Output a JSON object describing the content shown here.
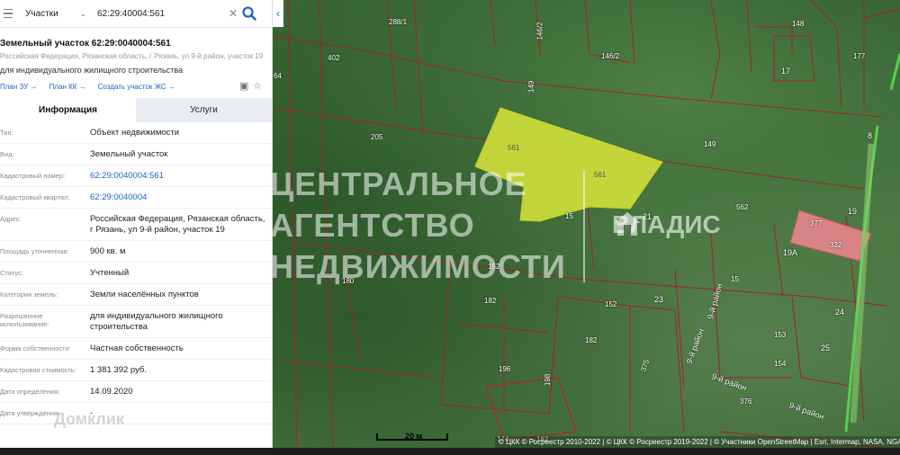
{
  "search": {
    "layer": "Участки",
    "query": "62:29:40004:561"
  },
  "parcel": {
    "title": "Земельный участок 62:29:0040004:561",
    "address": "Российская Федерация, Рязанская область, г Рязань, ул 9-й район, участок 19",
    "purpose": "для индивидуального жилищного строительства"
  },
  "actions": [
    "План ЗУ",
    "План КК",
    "Создать участок ЖС"
  ],
  "tabs": [
    "Информация",
    "Услуги"
  ],
  "info": [
    {
      "label": "Тип:",
      "value": "Объект недвижимости"
    },
    {
      "label": "Вид:",
      "value": "Земельный участок"
    },
    {
      "label": "Кадастровый номер:",
      "value": "62:29:0040004:561"
    },
    {
      "label": "Кадастровый квартал:",
      "value": "62:29:0040004"
    },
    {
      "label": "Адрес:",
      "value": "Российская Федерация, Рязанская область, г Рязань, ул 9-й район, участок 19"
    },
    {
      "label": "Площадь уточненная:",
      "value": "900 кв. м"
    },
    {
      "label": "Статус:",
      "value": "Учтенный"
    },
    {
      "label": "Категория земель:",
      "value": "Земли населённых пунктов"
    },
    {
      "label": "Разрешенное использование:",
      "value": "для индивидуального жилищного строительства"
    },
    {
      "label": "Форма собственности:",
      "value": "Частная собственность"
    },
    {
      "label": "Кадастровая стоимость:",
      "value": "1 381 392 руб."
    },
    {
      "label": "Дата определения:",
      "value": "14.09.2020"
    },
    {
      "label": "Дата утверждения:",
      "value": "-"
    }
  ],
  "map": {
    "watermark": [
      "ЦЕНТРАЛЬНОЕ",
      "АГЕНТСТВО",
      "НЕДВИЖИМОСТИ"
    ],
    "brand": "ВЛАДИС",
    "domclick": "Домклик",
    "scale": "20 м",
    "attribution": "© ЦКК © Росреестр 2010-2022 | © ЦКК © Росреестр 2019-2022 | © Участники OpenStreetMap | Esri, Intermap, NASA, NGA, USGS",
    "parcel_numbers": [
      "288/1",
      "148",
      "177",
      "146/2",
      "402",
      "146/2",
      "17",
      "64",
      "149",
      "205",
      "149",
      "8",
      "561",
      "561",
      "562",
      "21",
      "15",
      "19",
      "377",
      "332",
      "19А",
      "152",
      "180",
      "15",
      "182",
      "152",
      "23",
      "24",
      "153",
      "182",
      "25",
      "196",
      "198",
      "375",
      "154",
      "376",
      "174",
      "182"
    ],
    "streets": [
      "9-й район",
      "9-й район",
      "9-й район",
      "9-й район"
    ],
    "highlight_color": "#d8e639",
    "neighbor_color": "#e8848c"
  },
  "colors": {
    "accent": "#1a63c5",
    "boundary": "#a3222a"
  }
}
